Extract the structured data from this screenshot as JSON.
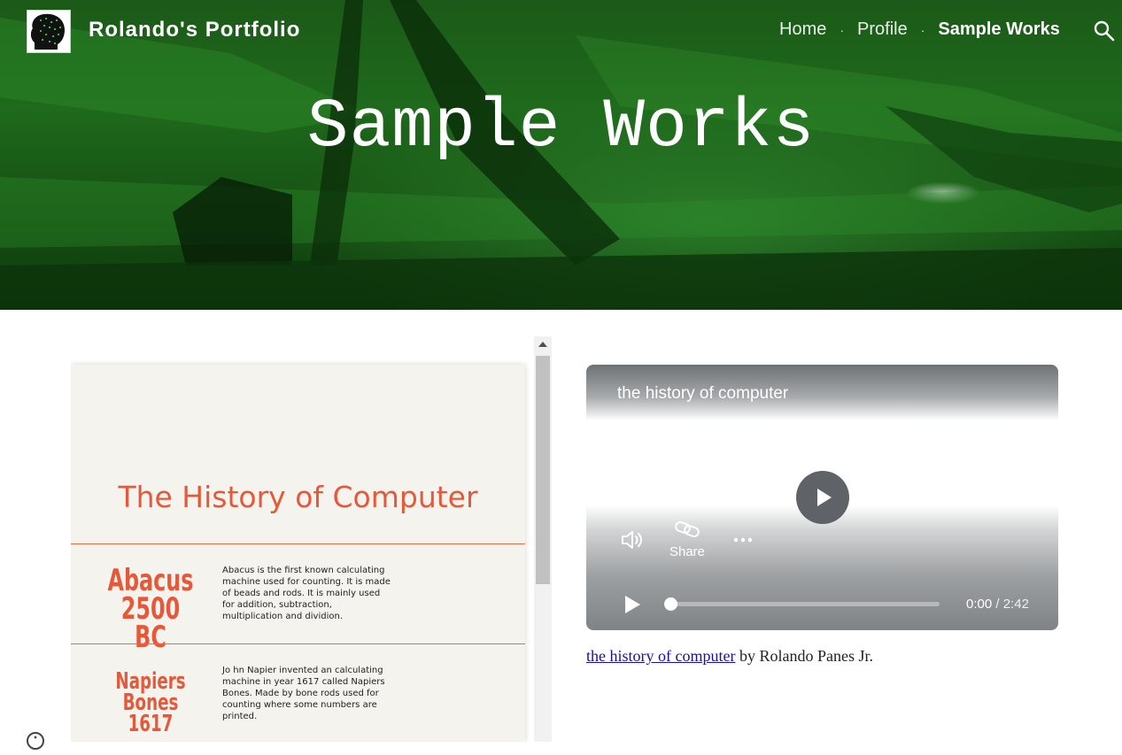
{
  "header": {
    "site_title": "Rolando's Portfolio",
    "nav": [
      {
        "label": "Home",
        "active": false
      },
      {
        "label": "Profile",
        "active": false
      },
      {
        "label": "Sample Works",
        "active": true
      }
    ],
    "search_icon": "search-icon",
    "logo_icon": "head-silhouette-logo"
  },
  "hero": {
    "title": "Sample Works",
    "background_color": "#1f6a1c"
  },
  "document": {
    "title": "The History of Computer",
    "entries": [
      {
        "heading_line1": "Abacus",
        "heading_line2": "2500 BC",
        "text": "Abacus is the first known calculating machine used for counting. It is made of beads and rods. It is mainly used for addition, subtraction, multiplication and dividion."
      },
      {
        "heading_line1": "Napiers",
        "heading_line2": "Bones",
        "heading_line3": "1617",
        "text": "Jo hn Napier invented an calculating machine in year 1617 called Napiers Bones. Made by bone rods used for counting where some numbers are printed."
      }
    ],
    "accent_color": "#e5593a"
  },
  "video": {
    "title": "the history of computer",
    "share_label": "Share",
    "current_time": "0:00",
    "duration": "2:42",
    "progress": 0
  },
  "caption": {
    "link_text": "the history of computer",
    "suffix": " by Rolando Panes Jr."
  }
}
